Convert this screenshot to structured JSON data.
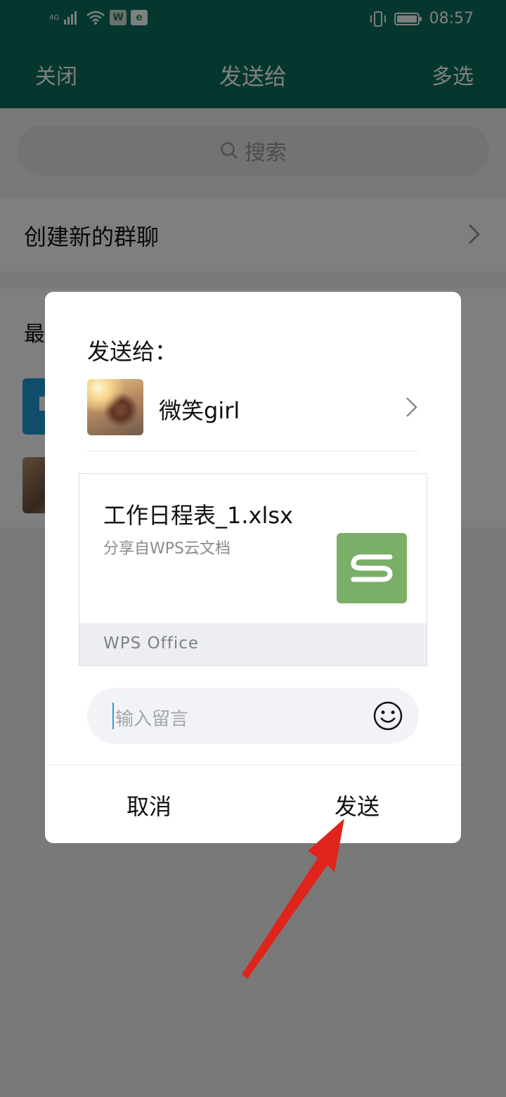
{
  "status_bar": {
    "network": "4G",
    "badge_w": "W",
    "badge_e": "e",
    "time": "08:57"
  },
  "header": {
    "close": "关闭",
    "title": "发送给",
    "multi_select": "多选"
  },
  "search": {
    "placeholder": "搜索"
  },
  "create_group": {
    "label": "创建新的群聊"
  },
  "recent": {
    "title_partial": "最"
  },
  "dialog": {
    "title": "发送给：",
    "recipient": {
      "name": "微笑girl"
    },
    "file": {
      "name": "工作日程表_1.xlsx",
      "subtitle": "分享自WPS云文档",
      "footer": "WPS Office",
      "app_icon": "wps-spreadsheet-icon"
    },
    "message": {
      "placeholder": "输入留言"
    },
    "buttons": {
      "cancel": "取消",
      "send": "发送"
    }
  },
  "colors": {
    "header_bg": "#0b6e5f",
    "wps_icon": "#7aaf67",
    "arrow": "#e0241b"
  }
}
